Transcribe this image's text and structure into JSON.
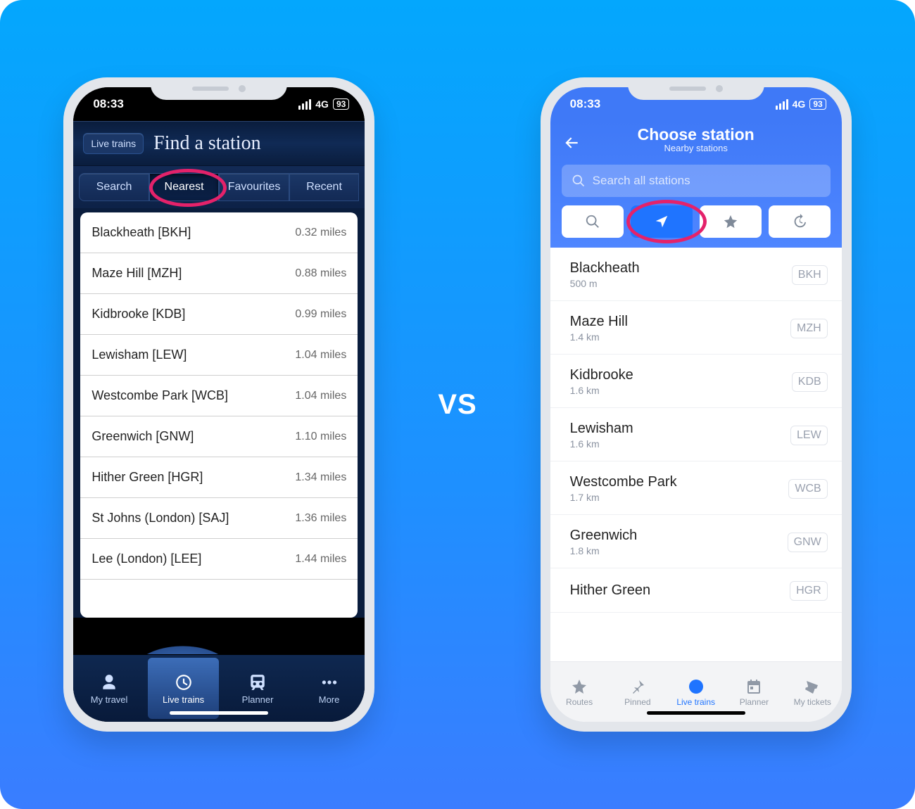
{
  "vs": "VS",
  "status": {
    "time": "08:33",
    "net": "4G",
    "batt": "93"
  },
  "phoneA": {
    "back": "Live trains",
    "title": "Find a station",
    "tabs": [
      "Search",
      "Nearest",
      "Favourites",
      "Recent"
    ],
    "activeTab": 1,
    "stations": [
      {
        "label": "Blackheath [BKH]",
        "dist": "0.32 miles"
      },
      {
        "label": "Maze Hill [MZH]",
        "dist": "0.88 miles"
      },
      {
        "label": "Kidbrooke [KDB]",
        "dist": "0.99 miles"
      },
      {
        "label": "Lewisham [LEW]",
        "dist": "1.04 miles"
      },
      {
        "label": "Westcombe Park [WCB]",
        "dist": "1.04 miles"
      },
      {
        "label": "Greenwich [GNW]",
        "dist": "1.10 miles"
      },
      {
        "label": "Hither Green [HGR]",
        "dist": "1.34 miles"
      },
      {
        "label": "St Johns (London) [SAJ]",
        "dist": "1.36 miles"
      },
      {
        "label": "Lee (London) [LEE]",
        "dist": "1.44 miles"
      }
    ],
    "bottom": [
      "My travel",
      "Live trains",
      "Planner",
      "More"
    ],
    "bottomActive": 1
  },
  "phoneB": {
    "title": "Choose station",
    "subtitle": "Nearby stations",
    "searchPlaceholder": "Search all stations",
    "segments": [
      "search",
      "location",
      "star",
      "history"
    ],
    "activeSegment": 1,
    "stations": [
      {
        "name": "Blackheath",
        "dist": "500 m",
        "code": "BKH"
      },
      {
        "name": "Maze Hill",
        "dist": "1.4 km",
        "code": "MZH"
      },
      {
        "name": "Kidbrooke",
        "dist": "1.6 km",
        "code": "KDB"
      },
      {
        "name": "Lewisham",
        "dist": "1.6 km",
        "code": "LEW"
      },
      {
        "name": "Westcombe Park",
        "dist": "1.7 km",
        "code": "WCB"
      },
      {
        "name": "Greenwich",
        "dist": "1.8 km",
        "code": "GNW"
      },
      {
        "name": "Hither Green",
        "dist": "",
        "code": "HGR"
      }
    ],
    "bottom": [
      "Routes",
      "Pinned",
      "Live trains",
      "Planner",
      "My tickets"
    ],
    "bottomActive": 2
  }
}
